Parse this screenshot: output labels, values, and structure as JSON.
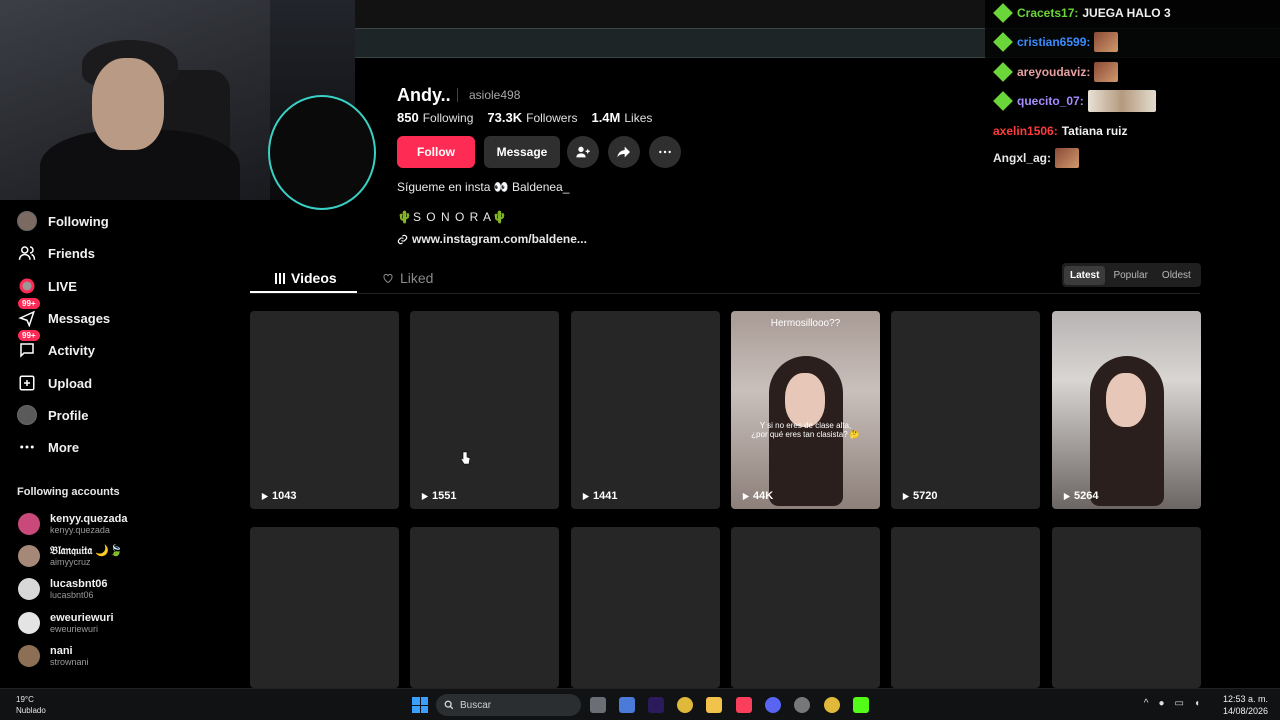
{
  "profile": {
    "name": "Andy..",
    "handle": "asiole498",
    "following_count": "850",
    "following_label": "Following",
    "followers_count": "73.3K",
    "followers_label": "Followers",
    "likes_count": "1.4M",
    "likes_label": "Likes",
    "follow_label": "Follow",
    "message_label": "Message",
    "bio_line1": "Sígueme en insta 👀 Baldenea_",
    "bio_line2": "🌵S O N O R A🌵",
    "link": "www.instagram.com/baldene..."
  },
  "sidebar": {
    "items": [
      {
        "label": "Following"
      },
      {
        "label": "Friends"
      },
      {
        "label": "LIVE"
      },
      {
        "label": "Messages",
        "badge": "99+"
      },
      {
        "label": "Activity",
        "badge": "99+"
      },
      {
        "label": "Upload"
      },
      {
        "label": "Profile"
      },
      {
        "label": "More"
      }
    ],
    "section_title": "Following accounts",
    "accounts": [
      {
        "name": "kenyy.quezada",
        "handle": "kenyy.quezada"
      },
      {
        "name": "𝔅𝔩𝔞𝔫𝔮𝔲𝔦𝔱𝔞 🌙🍃",
        "handle": "aimyycruz"
      },
      {
        "name": "lucasbnt06",
        "handle": "lucasbnt06"
      },
      {
        "name": "eweuriewuri",
        "handle": "eweuriewuri"
      },
      {
        "name": "nani",
        "handle": "strownani"
      }
    ]
  },
  "tabs": {
    "videos": "Videos",
    "liked": "Liked"
  },
  "sort": {
    "latest": "Latest",
    "popular": "Popular",
    "oldest": "Oldest"
  },
  "videos": [
    {
      "views": "1043"
    },
    {
      "views": "1551"
    },
    {
      "views": "1441"
    },
    {
      "views": "44K",
      "title": "Hermosillooo??",
      "caption": "Y si no eres de clase alta, ¿por qué eres tan clasista? 🤔"
    },
    {
      "views": "5720"
    },
    {
      "views": "5264"
    }
  ],
  "chat": [
    {
      "user": "Cracets17:",
      "color": "#6bd63a",
      "msg": "JUEGA HALO 3"
    },
    {
      "user": "cristian6599:",
      "color": "#3a8cff",
      "msg": ""
    },
    {
      "user": "areyoudaviz:",
      "color": "#e8a0a0",
      "msg": ""
    },
    {
      "user": "quecito_07:",
      "color": "#a68cff",
      "msg": ""
    },
    {
      "user": "axelin1506:",
      "color": "#ff3b3b",
      "msg": "Tatiana ruiz"
    },
    {
      "user": "Angxl_ag:",
      "color": "#e8e8e8",
      "msg": ""
    }
  ],
  "taskbar": {
    "temperature": "19°C",
    "weather": "Nublado",
    "search_placeholder": "Buscar",
    "time": "12:53 a. m.",
    "date": "14/08/2026"
  },
  "colors": {
    "accent": "#fe2c55",
    "ring": "#3ad0c4"
  }
}
